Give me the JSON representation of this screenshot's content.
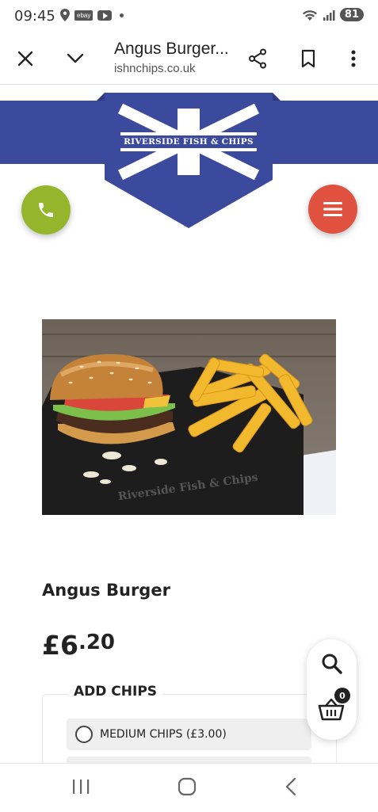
{
  "status": {
    "time": "09:45",
    "battery": "81",
    "ebay": "ebay"
  },
  "browser": {
    "title": "Angus Burger...",
    "domain": "ishnchips.co.uk"
  },
  "header": {
    "logo_text": "RIVERSIDE FISH & CHIPS",
    "brand_color": "#3c4a9e",
    "call_color": "#95b62c",
    "menu_color": "#e05140"
  },
  "product": {
    "name": "Angus Burger",
    "price_major": "£6",
    "price_minor": ".20",
    "image_watermark": "Riverside Fish & Chips"
  },
  "options": {
    "title": "ADD CHIPS",
    "items": [
      {
        "label": "MEDIUM CHIPS (£3.00)",
        "selected": false
      }
    ]
  },
  "cart": {
    "count": "0"
  }
}
